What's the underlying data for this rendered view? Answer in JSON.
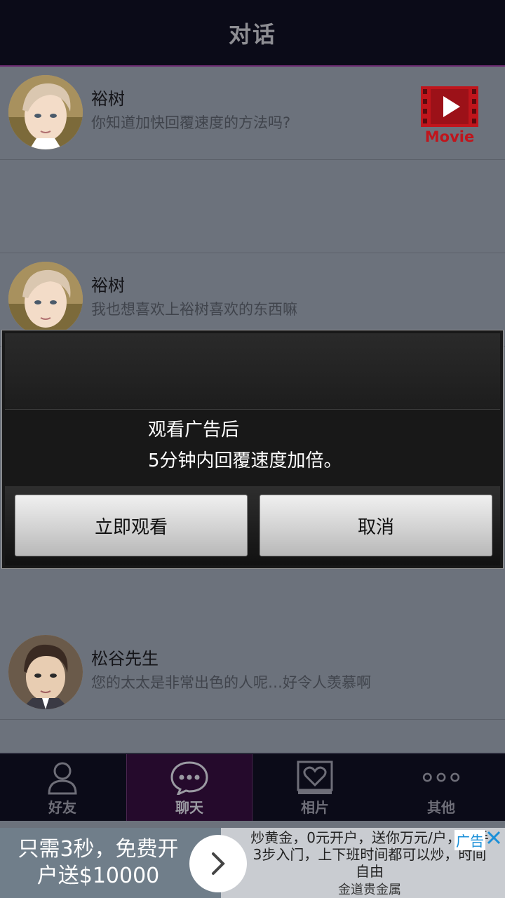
{
  "header": {
    "title": "对话"
  },
  "conversations": [
    {
      "name": "裕树",
      "message": "你知道加快回覆速度的方法吗?",
      "badge": "Movie"
    },
    {
      "name": "裕树",
      "message": "我也想喜欢上裕树喜欢的东西嘛"
    },
    {
      "name": "松谷先生",
      "message": "您的太太是非常出色的人呢…好令人羡慕啊"
    }
  ],
  "dialog": {
    "line1": "观看广告后",
    "line2": "5分钟内回覆速度加倍。",
    "confirm_label": "立即观看",
    "cancel_label": "取消"
  },
  "tabs": [
    {
      "label": "好友",
      "icon": "person-icon",
      "active": false
    },
    {
      "label": "聊天",
      "icon": "chat-bubble-icon",
      "active": true
    },
    {
      "label": "相片",
      "icon": "heart-photo-icon",
      "active": false
    },
    {
      "label": "其他",
      "icon": "more-dots-icon",
      "active": false
    }
  ],
  "ad": {
    "headline_line1": "只需3秒，免费开",
    "headline_line2": "户送$10000",
    "description": "炒黄金，0元开户，送你万元/户，新手3步入门，上下班时间都可以炒，时间自由",
    "sponsor": "金道贵金属",
    "ad_label": "广告"
  },
  "colors": {
    "header_bg": "#0b0b18",
    "accent_purple": "#6b2a70",
    "movie_red": "#c0151c",
    "list_bg": "#6c727c"
  }
}
